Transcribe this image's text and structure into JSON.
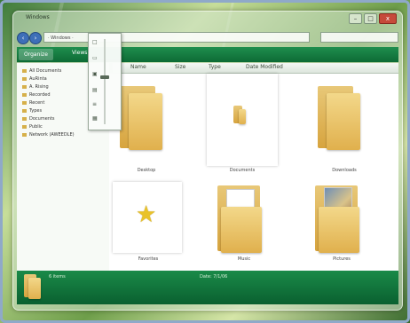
{
  "window": {
    "title": "Windows"
  },
  "address": {
    "path": "· Windows ·"
  },
  "toolbar": {
    "organize_label": "Organize",
    "views_label": "Views"
  },
  "columns": [
    "Name",
    "Size",
    "Type",
    "Date Modified"
  ],
  "nav": {
    "items": [
      "All Documents",
      "AuRinta",
      "A. Rising",
      "Recorded",
      "Recent",
      "Types",
      "Documents",
      "Public",
      "Network (AWEEDLE)"
    ]
  },
  "view_slider": {
    "marks": [
      "□",
      "▭",
      "▣",
      "▤",
      "≡",
      "▦"
    ],
    "level_fraction": 0.55
  },
  "tiles": [
    {
      "label": "Desktop",
      "kind": "folder"
    },
    {
      "label": "Documents",
      "kind": "folder-doc"
    },
    {
      "label": "Downloads",
      "kind": "folder"
    },
    {
      "label": "Favorites",
      "kind": "star"
    },
    {
      "label": "Music",
      "kind": "folder-music"
    },
    {
      "label": "Pictures",
      "kind": "folder-pictures"
    }
  ],
  "status": {
    "name": "6 items",
    "date": "Date: 7/1/06"
  },
  "colors": {
    "accent_green": "#0d6b35",
    "folder": "#e0b04d",
    "star": "#e9c22a"
  }
}
